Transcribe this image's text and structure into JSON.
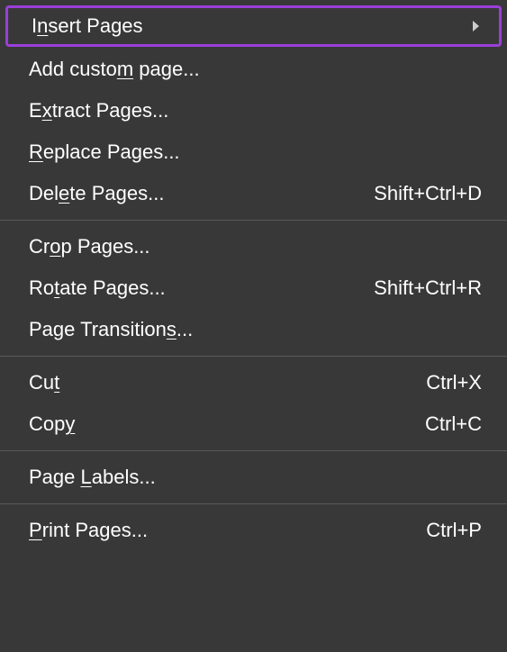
{
  "menu": {
    "groups": [
      [
        {
          "label_pre": "I",
          "label_u": "n",
          "label_post": "sert Pages",
          "shortcut": "",
          "submenu": true,
          "highlighted": true,
          "name": "insert-pages"
        },
        {
          "label_pre": "Add custo",
          "label_u": "m",
          "label_post": " page...",
          "shortcut": "",
          "submenu": false,
          "highlighted": false,
          "name": "add-custom-page"
        },
        {
          "label_pre": "E",
          "label_u": "x",
          "label_post": "tract Pages...",
          "shortcut": "",
          "submenu": false,
          "highlighted": false,
          "name": "extract-pages"
        },
        {
          "label_pre": "",
          "label_u": "R",
          "label_post": "eplace Pages...",
          "shortcut": "",
          "submenu": false,
          "highlighted": false,
          "name": "replace-pages"
        },
        {
          "label_pre": "Del",
          "label_u": "e",
          "label_post": "te Pages...",
          "shortcut": "Shift+Ctrl+D",
          "submenu": false,
          "highlighted": false,
          "name": "delete-pages"
        }
      ],
      [
        {
          "label_pre": "Cr",
          "label_u": "o",
          "label_post": "p Pages...",
          "shortcut": "",
          "submenu": false,
          "highlighted": false,
          "name": "crop-pages"
        },
        {
          "label_pre": "Ro",
          "label_u": "t",
          "label_post": "ate Pages...",
          "shortcut": "Shift+Ctrl+R",
          "submenu": false,
          "highlighted": false,
          "name": "rotate-pages"
        },
        {
          "label_pre": "Page Transition",
          "label_u": "s",
          "label_post": "...",
          "shortcut": "",
          "submenu": false,
          "highlighted": false,
          "name": "page-transitions"
        }
      ],
      [
        {
          "label_pre": "Cu",
          "label_u": "t",
          "label_post": "",
          "shortcut": "Ctrl+X",
          "submenu": false,
          "highlighted": false,
          "name": "cut"
        },
        {
          "label_pre": "Cop",
          "label_u": "y",
          "label_post": "",
          "shortcut": "Ctrl+C",
          "submenu": false,
          "highlighted": false,
          "name": "copy"
        }
      ],
      [
        {
          "label_pre": "Page ",
          "label_u": "L",
          "label_post": "abels...",
          "shortcut": "",
          "submenu": false,
          "highlighted": false,
          "name": "page-labels"
        }
      ],
      [
        {
          "label_pre": "",
          "label_u": "P",
          "label_post": "rint Pages...",
          "shortcut": "Ctrl+P",
          "submenu": false,
          "highlighted": false,
          "name": "print-pages"
        }
      ]
    ]
  }
}
